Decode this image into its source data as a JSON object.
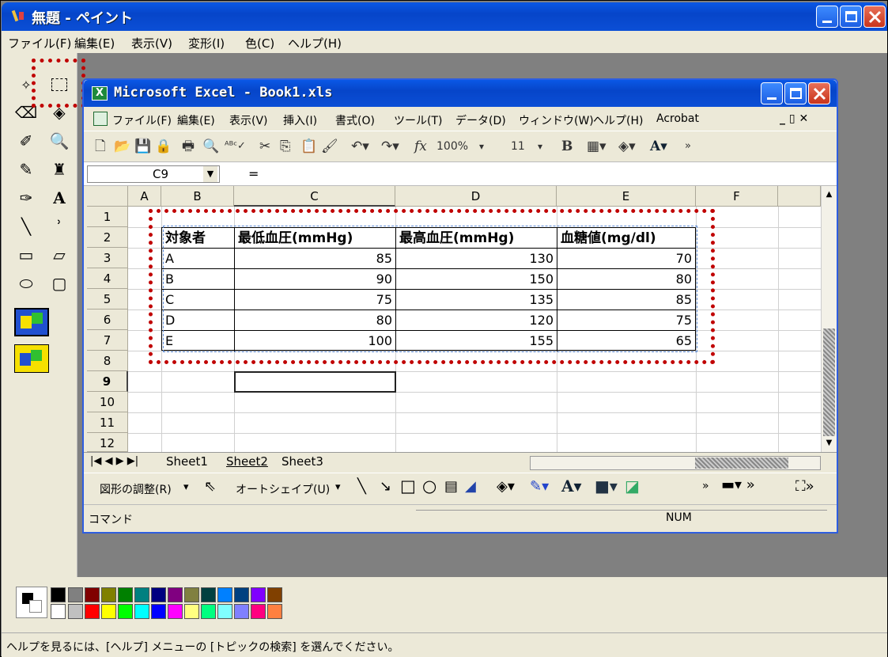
{
  "paint": {
    "title": "無題 - ペイント",
    "menu": [
      "ファイル(F)",
      "編集(E)",
      "表示(V)",
      "変形(I)",
      "色(C)",
      "ヘルプ(H)"
    ],
    "status": "ヘルプを見るには、[ヘルプ] メニューの [トピックの検索] を選んでください。"
  },
  "excel": {
    "title": "Microsoft Excel - Book1.xls",
    "menu": [
      "ファイル(F)",
      "編集(E)",
      "表示(V)",
      "挿入(I)",
      "書式(O)",
      "ツール(T)",
      "データ(D)",
      "ウィンドウ(W)",
      "ヘルプ(H)",
      "Acrobat"
    ],
    "zoom": "100%",
    "font_size": "11",
    "name_box": "C9",
    "formula_eq": "=",
    "columns": [
      "A",
      "B",
      "C",
      "D",
      "E",
      "F"
    ],
    "rows": [
      "1",
      "2",
      "3",
      "4",
      "5",
      "6",
      "7",
      "8",
      "9",
      "10",
      "11",
      "12"
    ],
    "table": {
      "headers": [
        "対象者",
        "最低血圧(mmHg)",
        "最高血圧(mmHg)",
        "血糖値(mg/dl)"
      ],
      "records": [
        [
          "A",
          "85",
          "130",
          "70"
        ],
        [
          "B",
          "90",
          "150",
          "80"
        ],
        [
          "C",
          "75",
          "135",
          "85"
        ],
        [
          "D",
          "80",
          "120",
          "75"
        ],
        [
          "E",
          "100",
          "155",
          "65"
        ]
      ]
    },
    "sheets": [
      "Sheet1",
      "Sheet2",
      "Sheet3"
    ],
    "drawing": {
      "adjust": "図形の調整(R)",
      "autoshape": "オートシェイプ(U)"
    },
    "status_left": "コマンド",
    "status_num": "NUM"
  },
  "colors": {
    "titlebar": "#0a58e6",
    "highlight": "#c00000",
    "palette_row1": [
      "#808080",
      "#800000",
      "#808000",
      "#008000",
      "#008080",
      "#000080",
      "#800080",
      "#808040",
      "#004040",
      "#0080ff",
      "#004080",
      "#8000ff",
      "#804000"
    ],
    "palette_row2": [
      "#c0c0c0",
      "#ff0000",
      "#ffff00",
      "#00ff00",
      "#00ffff",
      "#0000ff",
      "#ff00ff",
      "#ffff80",
      "#00ff80",
      "#80ffff",
      "#8080ff",
      "#ff0080",
      "#ff8040"
    ]
  }
}
